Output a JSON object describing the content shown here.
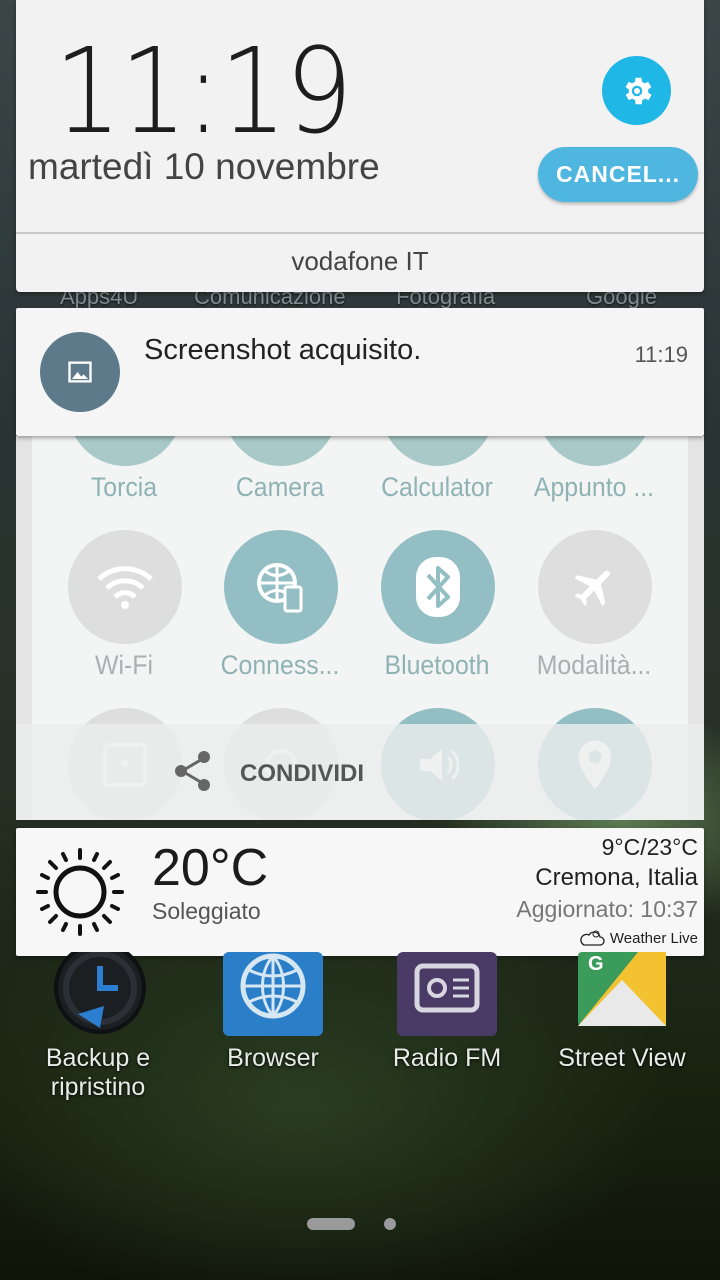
{
  "header": {
    "time": "11:19",
    "date": "martedì 10 novembre",
    "cancel_label": "CANCEL...",
    "carrier": "vodafone IT",
    "settings_icon": "gear-icon",
    "accent": "#1fb7e6"
  },
  "background_labels": [
    "Apps4U",
    "Comunicazione",
    "Fotografia",
    "Google"
  ],
  "notification": {
    "title": "Screenshot acquisito.",
    "time": "11:19",
    "icon": "image-icon",
    "icon_bg": "#5e7a8a"
  },
  "preview": {
    "row1_labels": [
      "Torcia",
      "Camera",
      "Calculator",
      "Appunto ..."
    ],
    "row2": [
      {
        "label": "Wi-Fi",
        "icon": "wifi-icon",
        "active": false
      },
      {
        "label": "Conness...",
        "icon": "data-connection-icon",
        "active": true
      },
      {
        "label": "Bluetooth",
        "icon": "bluetooth-icon",
        "active": true
      },
      {
        "label": "Modalità...",
        "icon": "airplane-icon",
        "active": false
      }
    ],
    "row3_icons": [
      "hotspot-icon",
      "sync-icon",
      "sound-icon",
      "location-icon"
    ],
    "share_label": "CONDIVIDI",
    "active_color": "#93bfc4",
    "inactive_color": "#dedede"
  },
  "weather": {
    "temperature": "20°C",
    "condition": "Soleggiato",
    "range": "9°C/23°C",
    "city": "Cremona, Italia",
    "updated": "Aggiornato: 10:37",
    "brand": "Weather Live",
    "icon": "sun-icon"
  },
  "home_apps": [
    {
      "label": "Backup e ripristino",
      "icon": "backup-icon"
    },
    {
      "label": "Browser",
      "icon": "globe-icon"
    },
    {
      "label": "Radio FM",
      "icon": "radio-icon"
    },
    {
      "label": "Street View",
      "icon": "street-view-icon"
    }
  ]
}
